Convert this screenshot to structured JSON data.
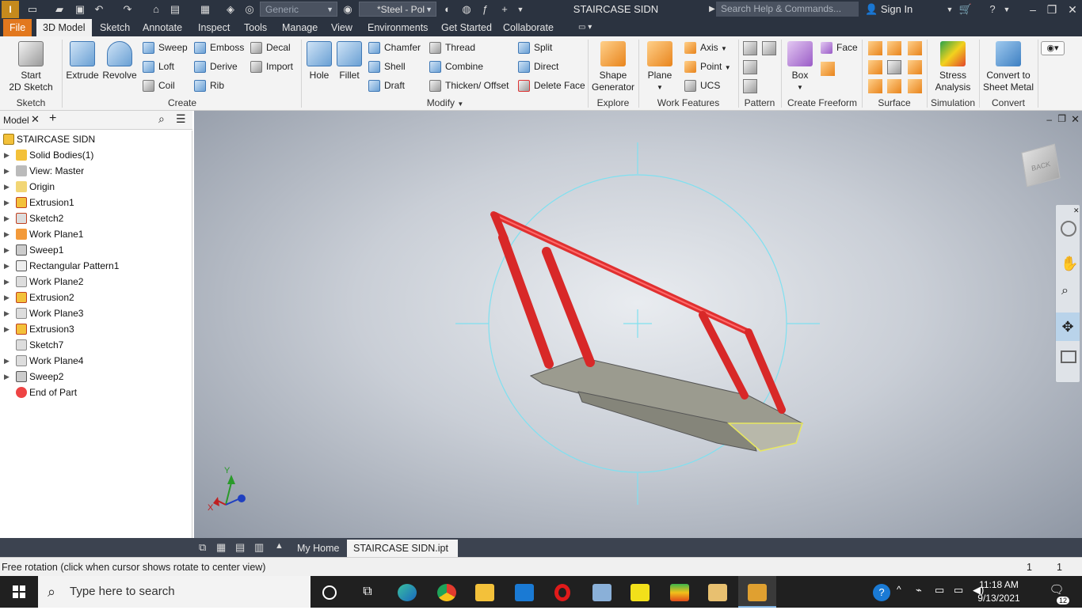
{
  "titlebar": {
    "app_logo": "I",
    "material_dropdown": "Generic",
    "appearance_dropdown": "*Steel - Pol",
    "document_title": "STAIRCASE SIDN",
    "search_placeholder": "Search Help & Commands...",
    "sign_in": "Sign In"
  },
  "menu": {
    "tabs": [
      "File",
      "3D Model",
      "Sketch",
      "Annotate",
      "Inspect",
      "Tools",
      "Manage",
      "View",
      "Environments",
      "Get Started",
      "Collaborate"
    ],
    "active": "3D Model"
  },
  "ribbon": {
    "sketch": {
      "start_sketch_line1": "Start",
      "start_sketch_line2": "2D Sketch",
      "label": "Sketch"
    },
    "create": {
      "extrude": "Extrude",
      "revolve": "Revolve",
      "sweep": "Sweep",
      "loft": "Loft",
      "coil": "Coil",
      "emboss": "Emboss",
      "derive": "Derive",
      "rib": "Rib",
      "decal": "Decal",
      "import": "Import",
      "label": "Create"
    },
    "modify": {
      "hole": "Hole",
      "fillet": "Fillet",
      "chamfer": "Chamfer",
      "shell": "Shell",
      "draft": "Draft",
      "thread": "Thread",
      "combine": "Combine",
      "thicken": "Thicken/ Offset",
      "split": "Split",
      "direct": "Direct",
      "delete_face": "Delete Face",
      "label": "Modify"
    },
    "explore": {
      "shape_generator_line1": "Shape",
      "shape_generator_line2": "Generator",
      "label": "Explore"
    },
    "work_features": {
      "plane": "Plane",
      "axis": "Axis",
      "point": "Point",
      "ucs": "UCS",
      "label": "Work Features"
    },
    "pattern": {
      "label": "Pattern"
    },
    "freeform": {
      "box": "Box",
      "face": "Face",
      "label": "Create Freeform"
    },
    "surface": {
      "label": "Surface"
    },
    "simulation": {
      "stress_line1": "Stress",
      "stress_line2": "Analysis",
      "label": "Simulation"
    },
    "convert": {
      "convert_line1": "Convert to",
      "convert_line2": "Sheet Metal",
      "label": "Convert"
    }
  },
  "browser": {
    "tab_label": "Model",
    "items": [
      {
        "label": "STAIRCASE SIDN",
        "icon": "part-icon"
      },
      {
        "label": "Solid Bodies(1)",
        "icon": "solid-bodies-icon"
      },
      {
        "label": "View: Master",
        "icon": "view-icon"
      },
      {
        "label": "Origin",
        "icon": "folder-icon"
      },
      {
        "label": "Extrusion1",
        "icon": "extrusion-icon"
      },
      {
        "label": "Sketch2",
        "icon": "sketch-icon"
      },
      {
        "label": "Work Plane1",
        "icon": "work-plane-icon"
      },
      {
        "label": "Sweep1",
        "icon": "sweep-icon"
      },
      {
        "label": "Rectangular Pattern1",
        "icon": "rectangular-pattern-icon"
      },
      {
        "label": "Work Plane2",
        "icon": "work-plane-icon"
      },
      {
        "label": "Extrusion2",
        "icon": "extrusion-icon"
      },
      {
        "label": "Work Plane3",
        "icon": "work-plane-icon"
      },
      {
        "label": "Extrusion3",
        "icon": "extrusion-icon"
      },
      {
        "label": "Sketch7",
        "icon": "sketch-icon"
      },
      {
        "label": "Work Plane4",
        "icon": "work-plane-icon"
      },
      {
        "label": "Sweep2",
        "icon": "sweep-icon"
      },
      {
        "label": "End of Part",
        "icon": "end-of-part-icon"
      }
    ]
  },
  "viewport": {
    "viewcube_label": "BACK",
    "triad": {
      "x": "X",
      "y": "Y"
    }
  },
  "doc_tabs": {
    "home": "My Home",
    "active_doc": "STAIRCASE SIDN.ipt"
  },
  "status": {
    "message": "Free rotation (click when cursor shows rotate to center view)",
    "count1": "1",
    "count2": "1"
  },
  "taskbar": {
    "search_placeholder": "Type here to search",
    "time": "11:18 AM",
    "date": "9/13/2021",
    "notifications": "12"
  }
}
